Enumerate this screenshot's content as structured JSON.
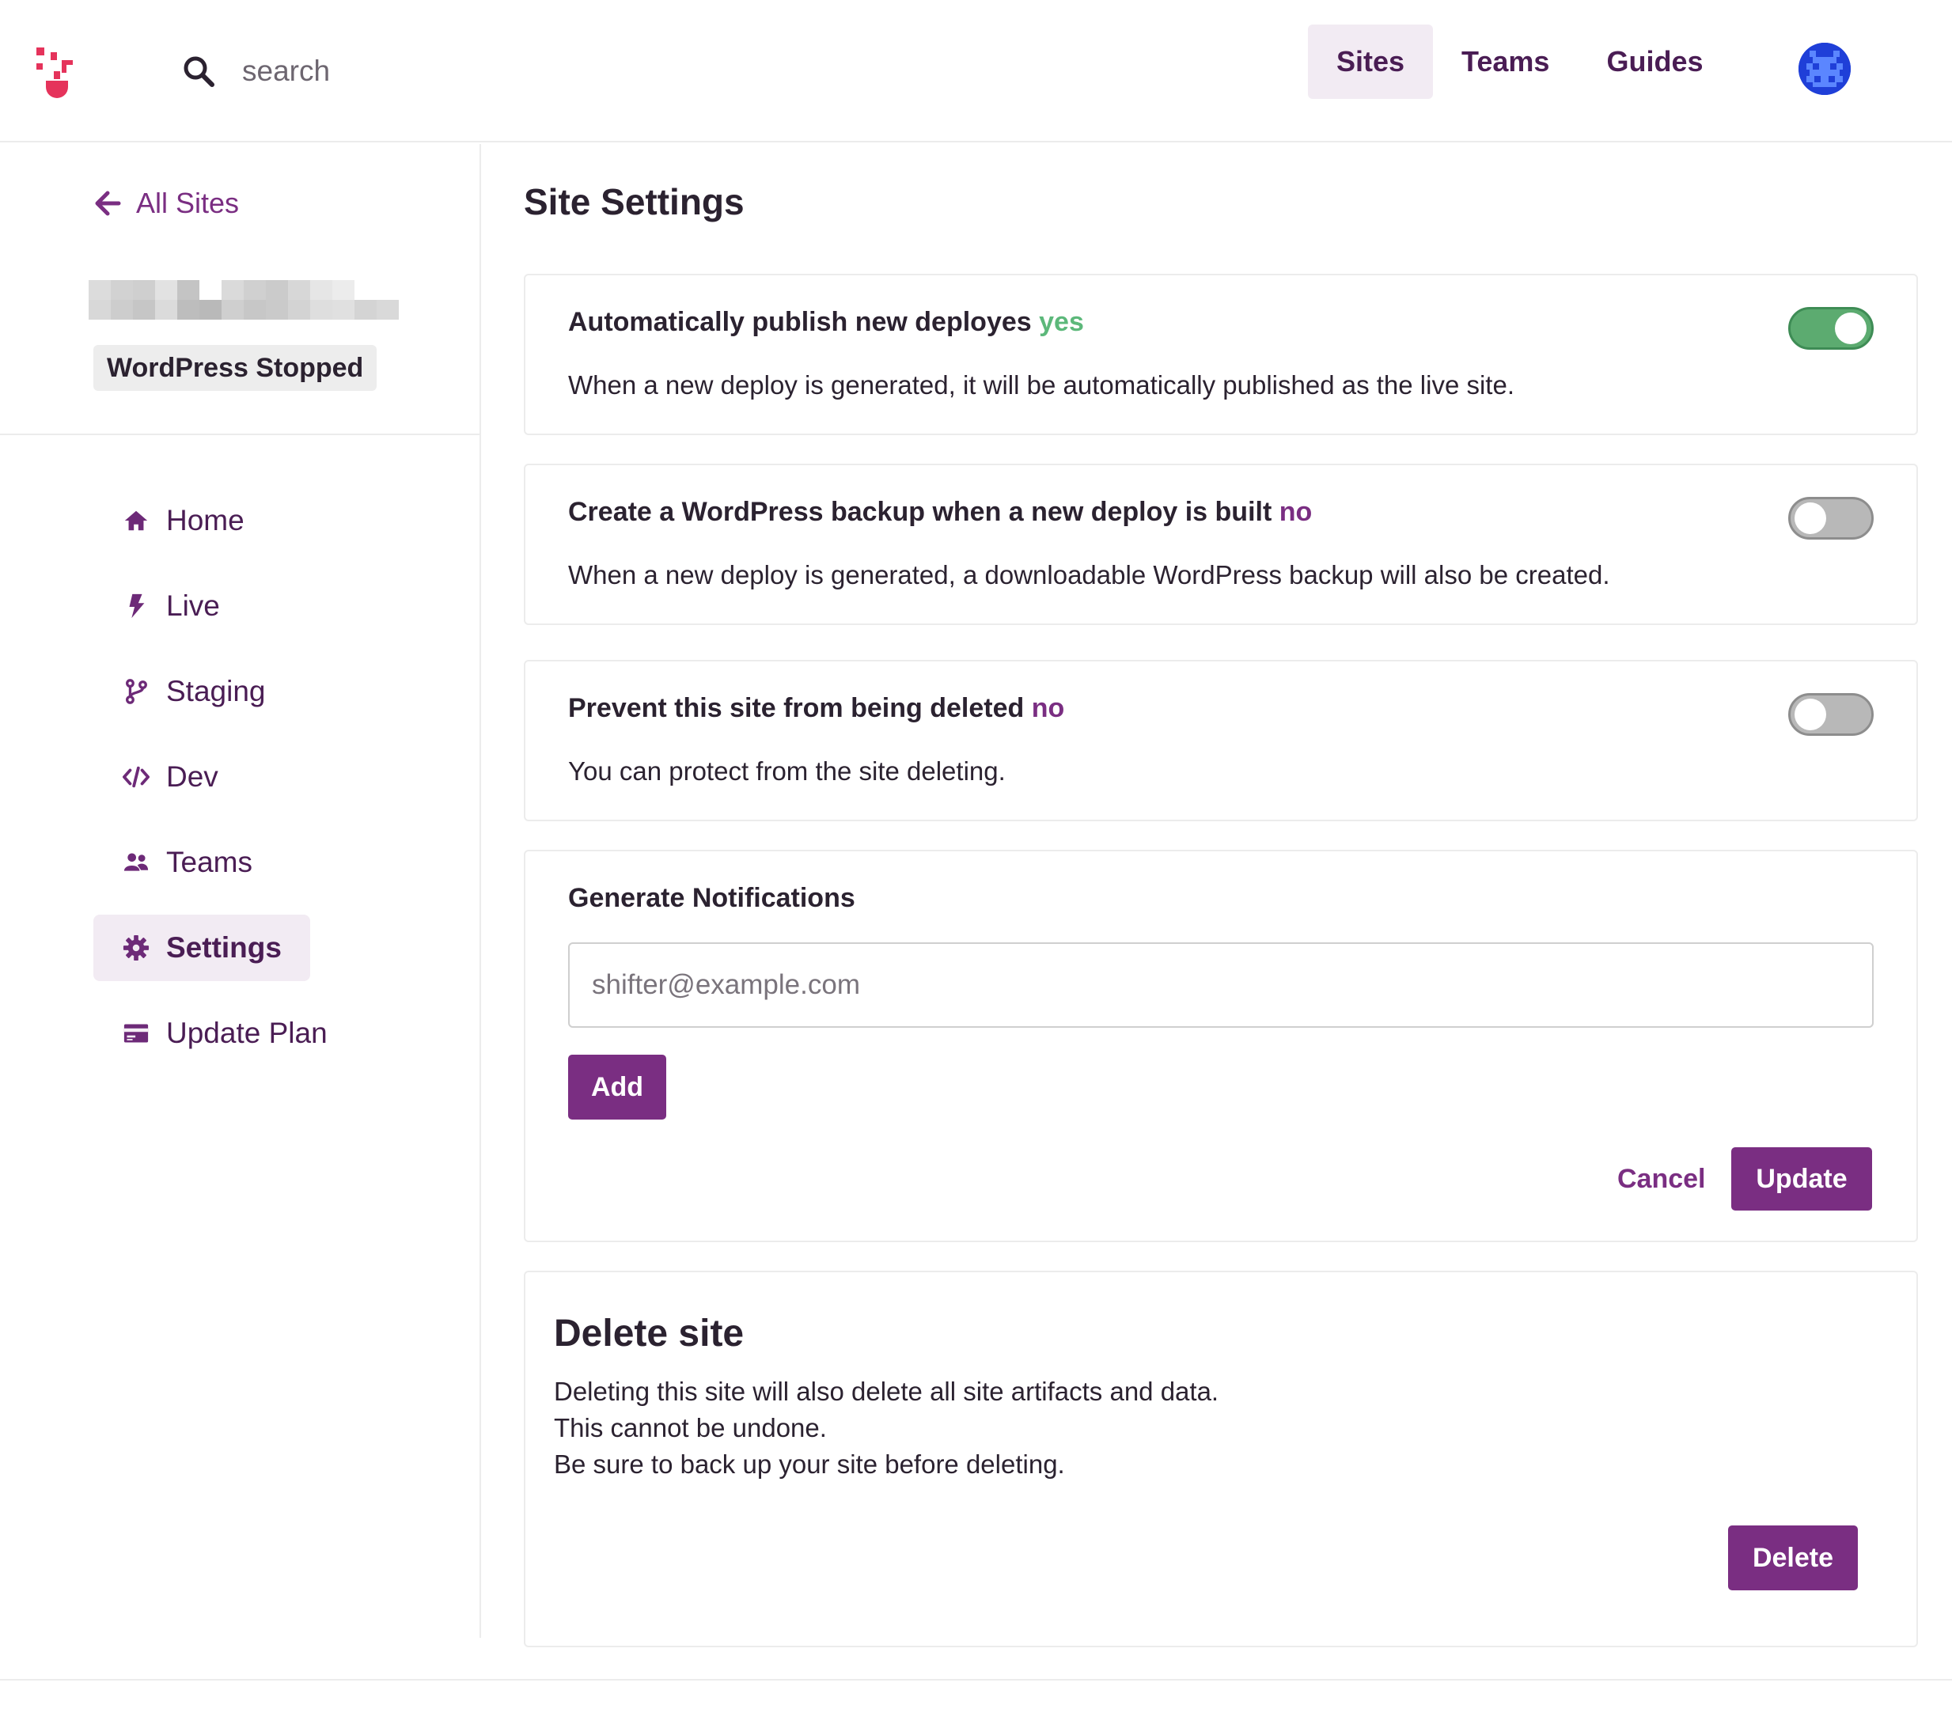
{
  "header": {
    "search_placeholder": "search",
    "nav": [
      "Sites",
      "Teams",
      "Guides"
    ],
    "active_nav": "Sites"
  },
  "sidebar": {
    "back_label": "All Sites",
    "status_badge": "WordPress Stopped",
    "items": [
      {
        "label": "Home",
        "icon": "home-icon"
      },
      {
        "label": "Live",
        "icon": "bolt-icon"
      },
      {
        "label": "Staging",
        "icon": "branch-icon"
      },
      {
        "label": "Dev",
        "icon": "code-icon"
      },
      {
        "label": "Teams",
        "icon": "users-icon"
      },
      {
        "label": "Settings",
        "icon": "gear-icon"
      },
      {
        "label": "Update Plan",
        "icon": "card-icon"
      }
    ],
    "active_item": "Settings"
  },
  "main": {
    "title": "Site Settings",
    "auto_publish": {
      "title": "Automatically publish new deployes",
      "state": "yes",
      "description": "When a new deploy is generated, it will be automatically published as the live site.",
      "enabled": true
    },
    "backup": {
      "title": "Create a WordPress backup when a new deploy is built",
      "state": "no",
      "description": "When a new deploy is generated, a downloadable WordPress backup will also be created.",
      "enabled": false
    },
    "prevent_delete": {
      "title": "Prevent this site from being deleted",
      "state": "no",
      "description": "You can protect from the site deleting.",
      "enabled": false
    },
    "notifications": {
      "title": "Generate Notifications",
      "email_placeholder": "shifter@example.com",
      "email_value": "",
      "add_label": "Add",
      "cancel_label": "Cancel",
      "update_label": "Update"
    },
    "delete_site": {
      "title": "Delete site",
      "lines": [
        "Deleting this site will also delete all site artifacts and data.",
        "This cannot be undone.",
        "Be sure to back up your site before deleting."
      ],
      "delete_label": "Delete"
    }
  },
  "colors": {
    "accent": "#7a2e82",
    "accent_dark": "#4a1d54",
    "success": "#5cb87a",
    "logo": "#e5335b",
    "nav_active_bg": "#f2ebf3"
  }
}
